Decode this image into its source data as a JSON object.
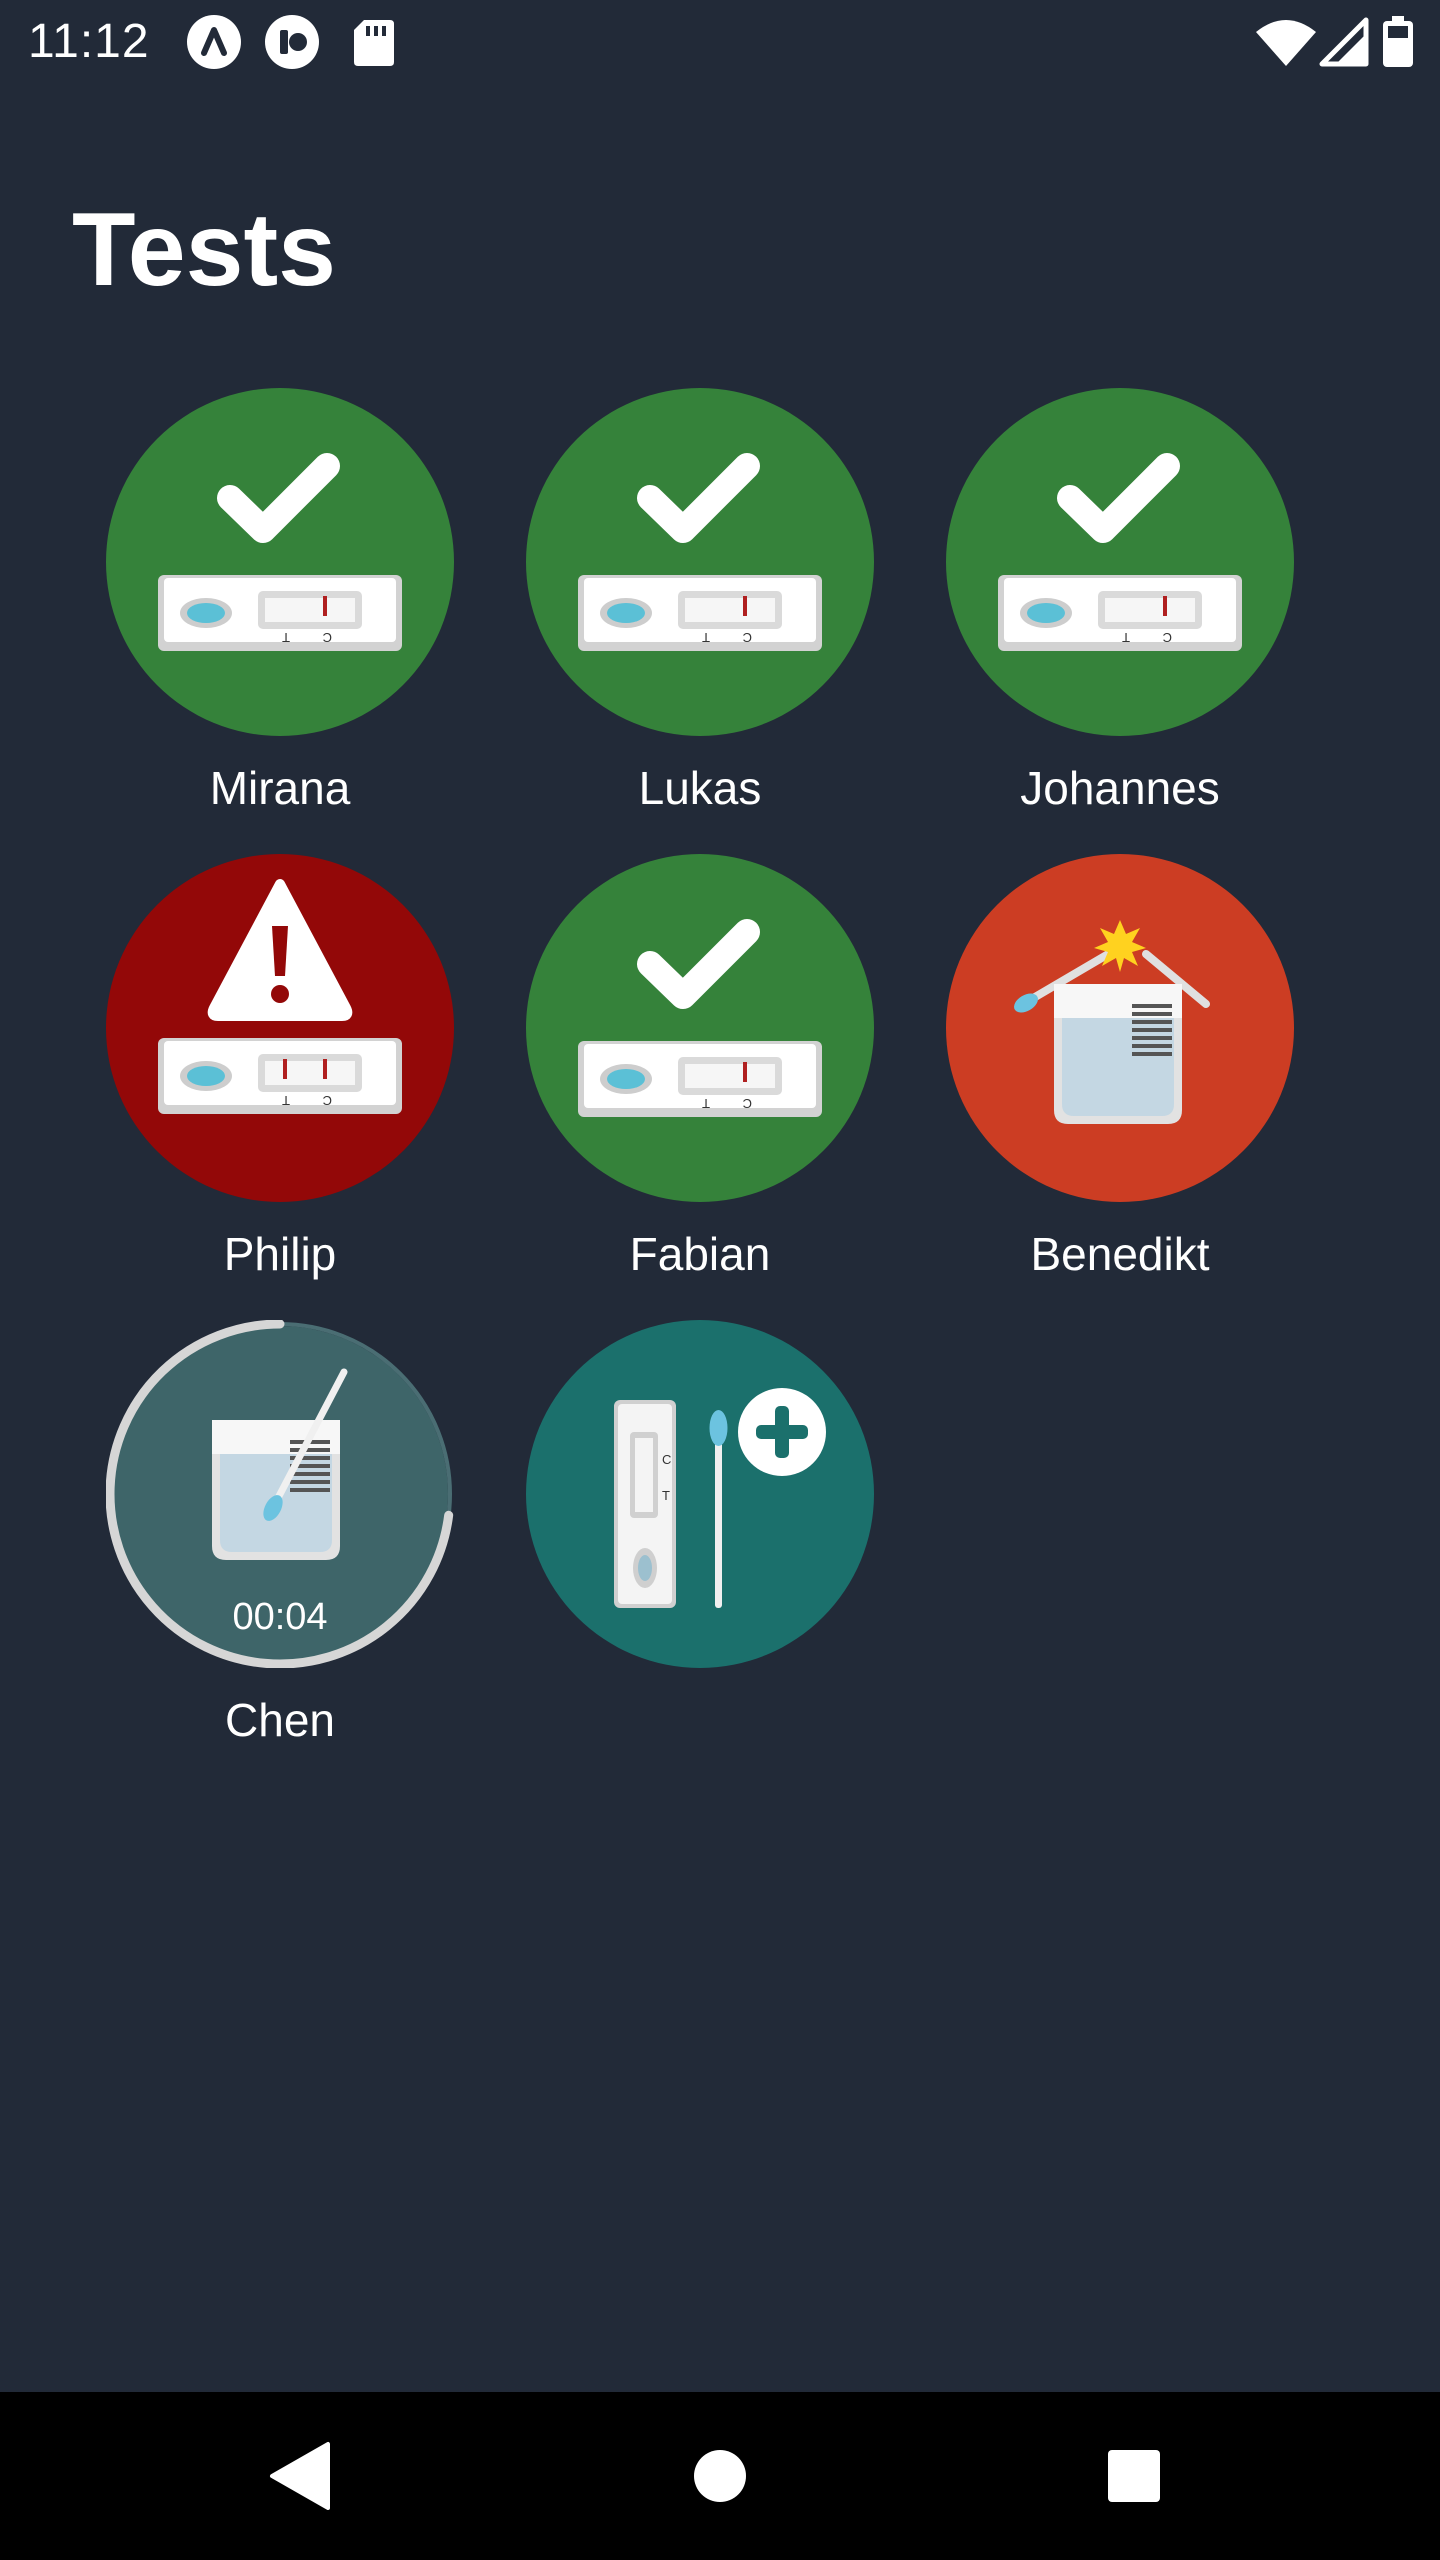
{
  "status_bar": {
    "time": "11:12",
    "icons": [
      "app-a-icon",
      "app-b-icon",
      "sd-card-icon",
      "wifi-icon",
      "signal-icon",
      "battery-icon"
    ]
  },
  "page": {
    "title": "Tests"
  },
  "tests": [
    {
      "name": "Mirana",
      "status": "negative",
      "icon": "check-icon",
      "color": "#35823a"
    },
    {
      "name": "Lukas",
      "status": "negative",
      "icon": "check-icon",
      "color": "#35823a"
    },
    {
      "name": "Johannes",
      "status": "negative",
      "icon": "check-icon",
      "color": "#35823a"
    },
    {
      "name": "Philip",
      "status": "positive",
      "icon": "warning-icon",
      "color": "#930808"
    },
    {
      "name": "Fabian",
      "status": "negative",
      "icon": "check-icon",
      "color": "#35823a"
    },
    {
      "name": "Benedikt",
      "status": "invalid",
      "icon": "spoiled-sample-icon",
      "color": "#cc3d23"
    },
    {
      "name": "Chen",
      "status": "running",
      "icon": "sample-tube-icon",
      "color": "#3e6569",
      "timer": "00:04",
      "progress": 0.27
    }
  ],
  "add_test": {
    "icon": "add-test-icon",
    "color": "#1b706c"
  },
  "nav": {
    "back_icon": "back-icon",
    "home_icon": "home-icon",
    "recents_icon": "recents-icon"
  }
}
